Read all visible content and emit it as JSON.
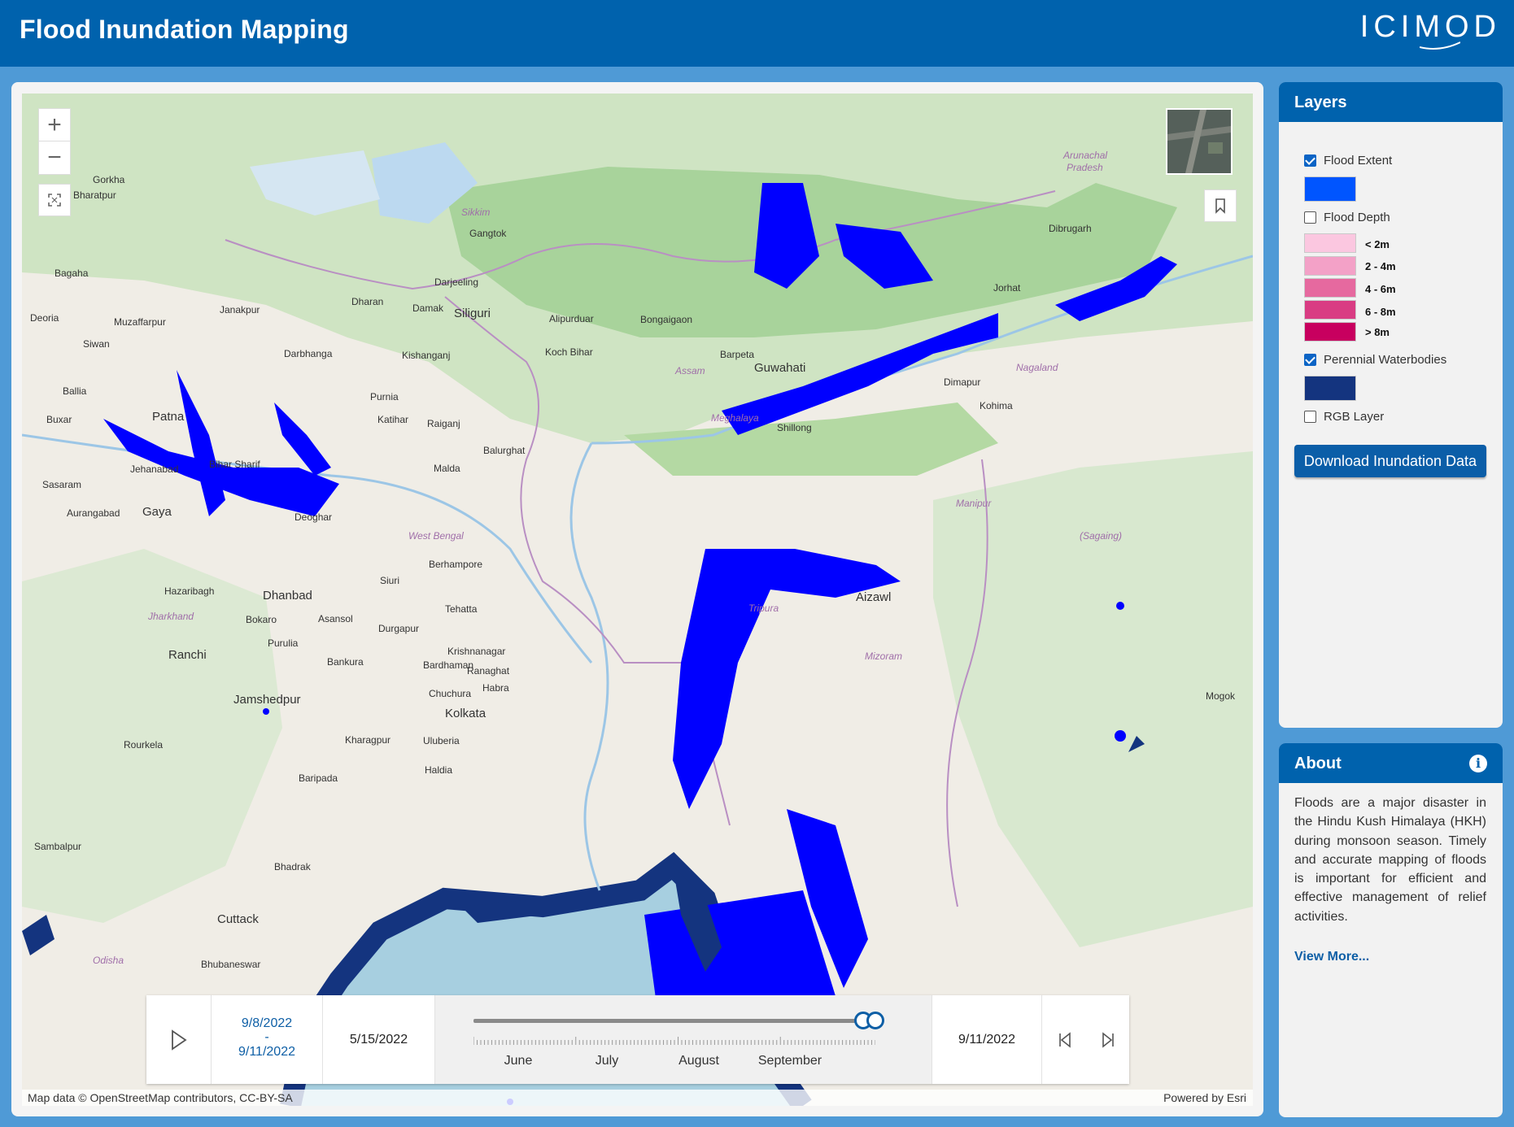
{
  "header": {
    "title": "Flood Inundation Mapping",
    "brand": "ICIMOD"
  },
  "map": {
    "zoom_in": "+",
    "zoom_out": "−",
    "attribution_left": "Map data © OpenStreetMap contributors, CC-BY-SA",
    "attribution_right": "Powered by Esri",
    "place_labels": [
      "Gorkha",
      "Bharatpur",
      "Bagaha",
      "Deoria",
      "Siwan",
      "Ballia",
      "Buxar",
      "Patna",
      "Sasaram",
      "Aurangabad",
      "Gaya",
      "Jehanabad",
      "Bihar Sharif",
      "Deoghar",
      "Hazaribagh",
      "Dhanbad",
      "Bokaro",
      "Purulia",
      "Ranchi",
      "Jamshedpur",
      "Rourkela",
      "Sambalpur",
      "Cuttack",
      "Bhubaneswar",
      "Odisha",
      "Jharkhand",
      "West Bengal",
      "Bankura",
      "Durgapur",
      "Asansol",
      "Siuri",
      "Berhampore",
      "Krishnanagar",
      "Bardhaman",
      "Chuchura",
      "Kolkata",
      "Kharagpur",
      "Haldia",
      "Uluberia",
      "Baripada",
      "Bhadrak",
      "Dharan",
      "Damak",
      "Siliguri",
      "Darjeeling",
      "Sikkim",
      "Gangtok",
      "Kishanganj",
      "Purnia",
      "Katihar",
      "Raiganj",
      "Balurghat",
      "Malda",
      "Alipurduar",
      "Bongaigaon",
      "Koch Bihar",
      "Assam",
      "Barpeta",
      "Guwahati",
      "Meghalaya",
      "Shillong",
      "Dimapur",
      "Kohima",
      "Nagaland",
      "Jorhat",
      "Dibrugarh",
      "Arunachal Pradesh",
      "Manipur",
      "Tripura",
      "Aizawl",
      "Mizoram",
      "Mogok",
      "Deoria",
      "Muzaffarpur",
      "Janakpur",
      "Darbhanga",
      "Tehatta",
      "Ranaghat",
      "Habra",
      "(Sagaing)"
    ]
  },
  "time_slider": {
    "current_start": "9/8/2022",
    "current_sep": "-",
    "current_end": "9/11/2022",
    "min_date": "5/15/2022",
    "max_date": "9/11/2022",
    "months": [
      "June",
      "July",
      "August",
      "September"
    ],
    "thumb_start_fraction": 0.97,
    "thumb_end_fraction": 1.0
  },
  "layers": {
    "title": "Layers",
    "items": [
      {
        "label": "Flood Extent",
        "checked": true,
        "color": "#0055ff"
      },
      {
        "label": "Flood Depth",
        "checked": false
      },
      {
        "label": "Perennial Waterbodies",
        "checked": true,
        "color": "#14347f"
      },
      {
        "label": "RGB Layer",
        "checked": false
      }
    ],
    "depth_classes": [
      {
        "label": "< 2m",
        "color": "#fbc7e0"
      },
      {
        "label": "2 - 4m",
        "color": "#f3a1c7"
      },
      {
        "label": "4 - 6m",
        "color": "#e6699f"
      },
      {
        "label": "6 - 8m",
        "color": "#d93c83"
      },
      {
        "label": "> 8m",
        "color": "#c8005f"
      }
    ],
    "download_label": "Download Inundation Data"
  },
  "about": {
    "title": "About",
    "info_icon": "i",
    "text": "Floods are a major disaster in the Hindu Kush Himalaya (HKH) during monsoon season. Timely and accurate mapping of floods is important for efficient and effective management of relief activities.",
    "link": "View More..."
  },
  "colors": {
    "header": "#0062ad",
    "background": "#4f9ad6",
    "flood": "#0000ff",
    "waterbody": "#14347f"
  }
}
